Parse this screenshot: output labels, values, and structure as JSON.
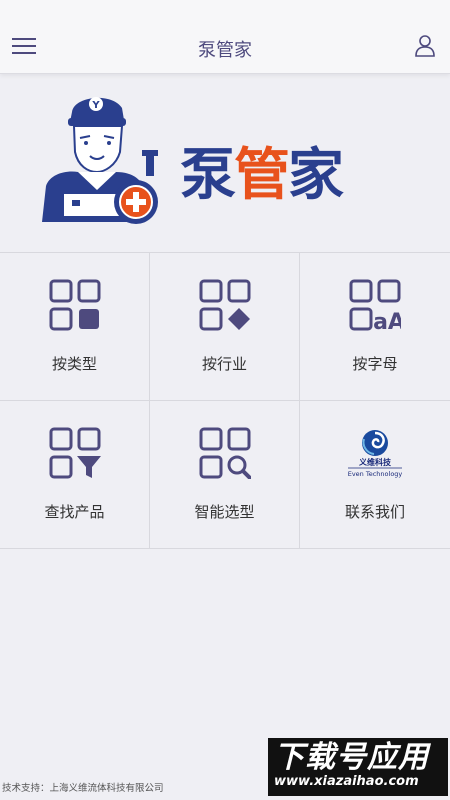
{
  "header": {
    "title": "泵管家",
    "menu_icon": "hamburger-menu-icon",
    "user_icon": "user-icon"
  },
  "logo": {
    "brand_chars": [
      "泵",
      "管",
      "家"
    ],
    "brand_colors": {
      "blue": "#2a3f8e",
      "orange": "#e8521c"
    }
  },
  "menu": [
    {
      "label": "按类型",
      "icon": "category-grid-icon"
    },
    {
      "label": "按行业",
      "icon": "industry-grid-icon"
    },
    {
      "label": "按字母",
      "icon": "alphabet-grid-icon"
    },
    {
      "label": "查找产品",
      "icon": "filter-grid-icon"
    },
    {
      "label": "智能选型",
      "icon": "search-grid-icon"
    },
    {
      "label": "联系我们",
      "icon": "even-technology-logo",
      "logo_text": "义维科技",
      "logo_subtext": "Even Technology"
    }
  ],
  "footer": {
    "text": "技术支持：上海义维流体科技有限公司"
  },
  "watermark": {
    "main": "下载号应用",
    "url": "www.xiazaihao.com"
  },
  "colors": {
    "icon": "#4e4a7e",
    "background": "#efeff4"
  }
}
